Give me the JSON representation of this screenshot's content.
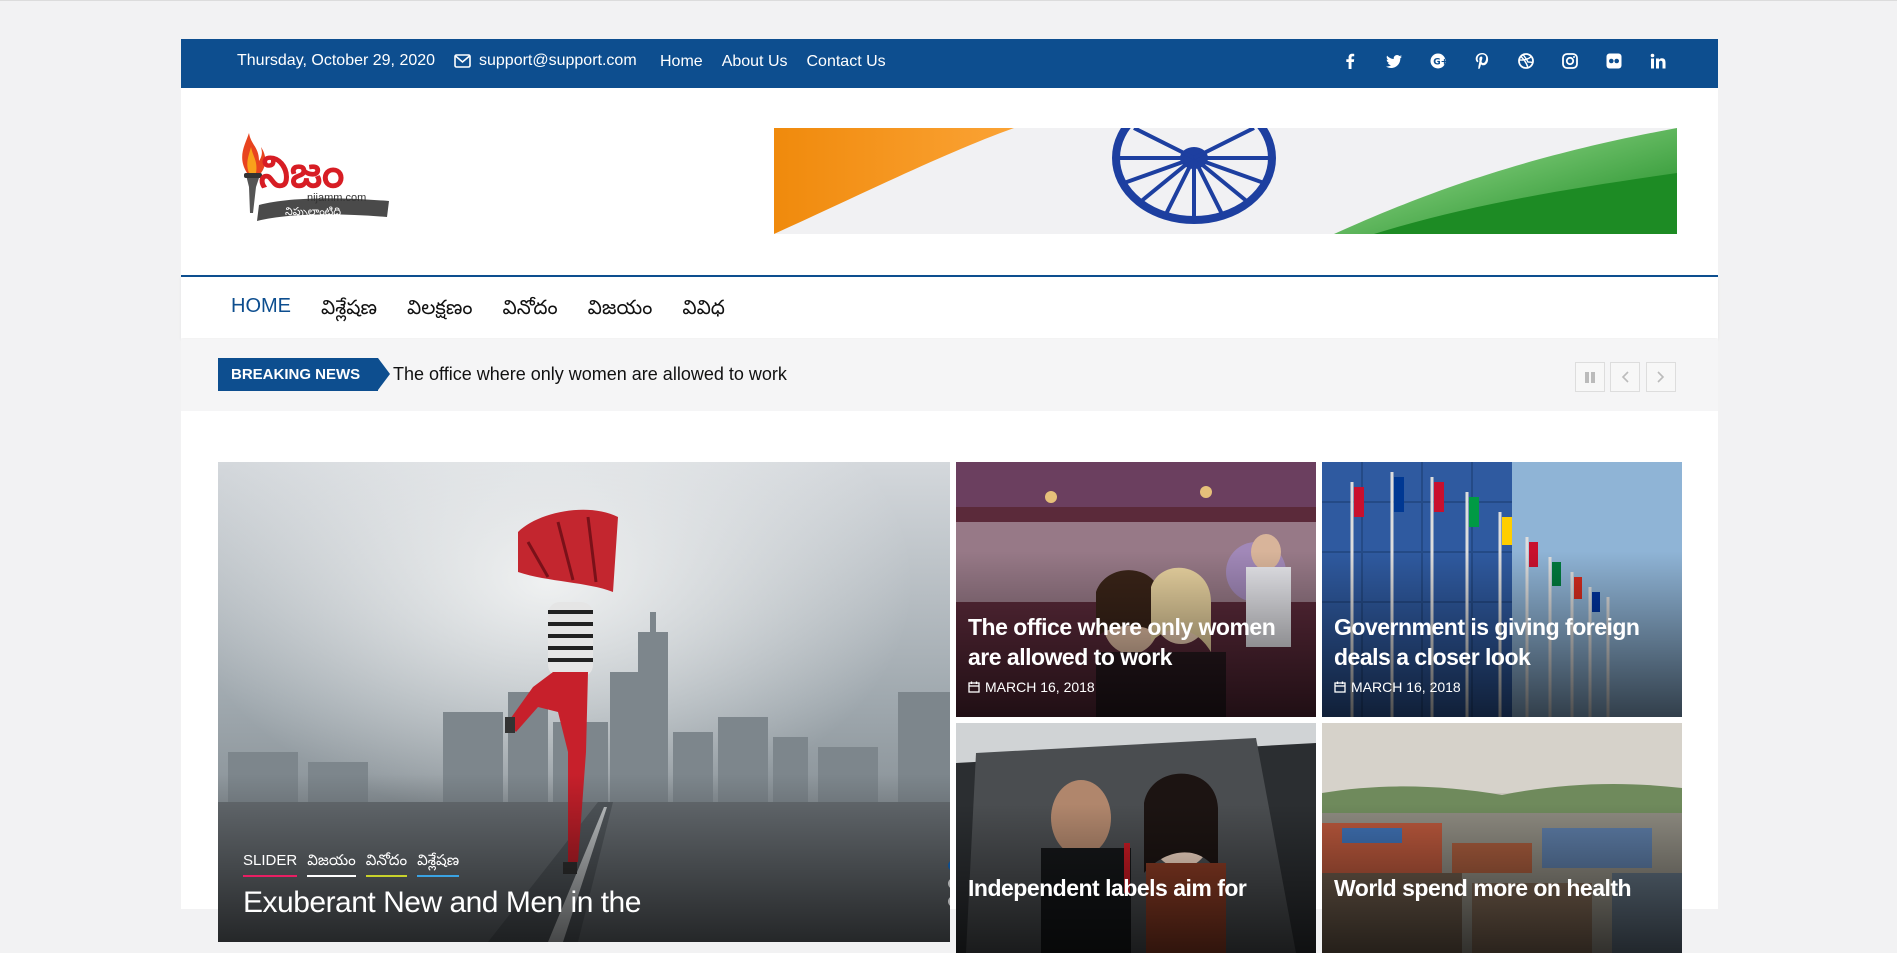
{
  "topbar": {
    "date": "Thursday, October 29, 2020",
    "email": "support@support.com",
    "links": [
      "Home",
      "About Us",
      "Contact Us"
    ],
    "social": [
      "facebook-icon",
      "twitter-icon",
      "google-plus-icon",
      "pinterest-icon",
      "dribbble-icon",
      "instagram-icon",
      "flickr-icon",
      "linkedin-icon"
    ]
  },
  "logo": {
    "text": "నిజం",
    "domain": "nijamm.com",
    "tagline": "నిప్పులాంటిది"
  },
  "nav": {
    "items": [
      "HOME",
      "విశ్లేషణ",
      "విలక్షణం",
      "వినోదం",
      "విజయం",
      "వివిధ"
    ]
  },
  "breaking": {
    "label": "BREAKING NEWS",
    "headline": "The office where only women are allowed to work"
  },
  "featured": {
    "tags": [
      "SLIDER",
      "విజయం",
      "వినోదం",
      "విశ్లేషణ"
    ],
    "tag_colors": [
      "#e91e63",
      "#ffffff",
      "#c8d22b",
      "#3aa3e3"
    ],
    "title": "Exuberant New and Men in the"
  },
  "tiles": [
    {
      "title": "The office where only women are allowed to work",
      "date": "MARCH 16, 2018"
    },
    {
      "title": "Government is giving foreign deals a closer look",
      "date": "MARCH 16, 2018"
    },
    {
      "title": "Independent labels aim for",
      "date": ""
    },
    {
      "title": "World spend more on health",
      "date": ""
    }
  ],
  "colors": {
    "brand": "#0d4e8f"
  }
}
